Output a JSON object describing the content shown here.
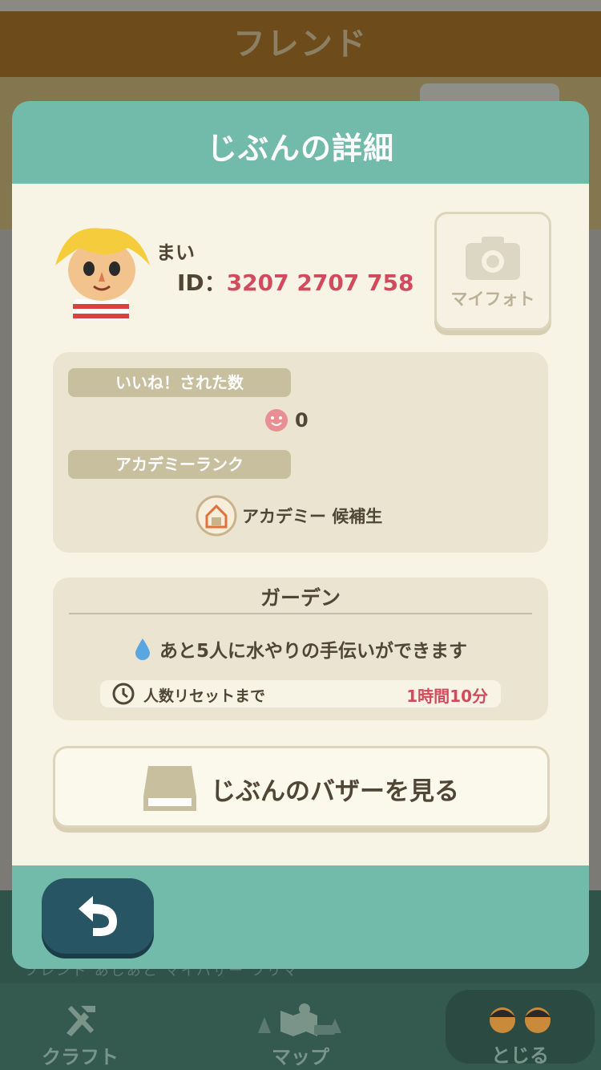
{
  "background": {
    "header_title": "フレンド",
    "subtabs": "フレンド あしあと マイバザー フリマ"
  },
  "modal": {
    "title": "じぶんの詳細",
    "profile": {
      "name": "まい",
      "id_label": "ID：",
      "id_value": "3207 2707 758"
    },
    "myphoto_label": "マイフォト",
    "likes": {
      "label": "いいね！された数",
      "count": "0"
    },
    "academy": {
      "label": "アカデミーランク",
      "rank": "アカデミー 候補生"
    },
    "garden": {
      "title": "ガーデン",
      "water_text": "あと5人に水やりの手伝いができます",
      "reset_label": "人数リセットまで",
      "reset_time": "1時間10分"
    },
    "bazaar_button": "じぶんのバザーを見る",
    "back_icon": "undo-arrow-icon"
  },
  "bottom_nav": {
    "craft": "クラフト",
    "map": "マップ",
    "close": "とじる"
  },
  "colors": {
    "teal": "#72bbab",
    "cream": "#f8f4e5",
    "panel": "#ebe4d0",
    "accent_red": "#d14a5d",
    "text": "#514636"
  }
}
